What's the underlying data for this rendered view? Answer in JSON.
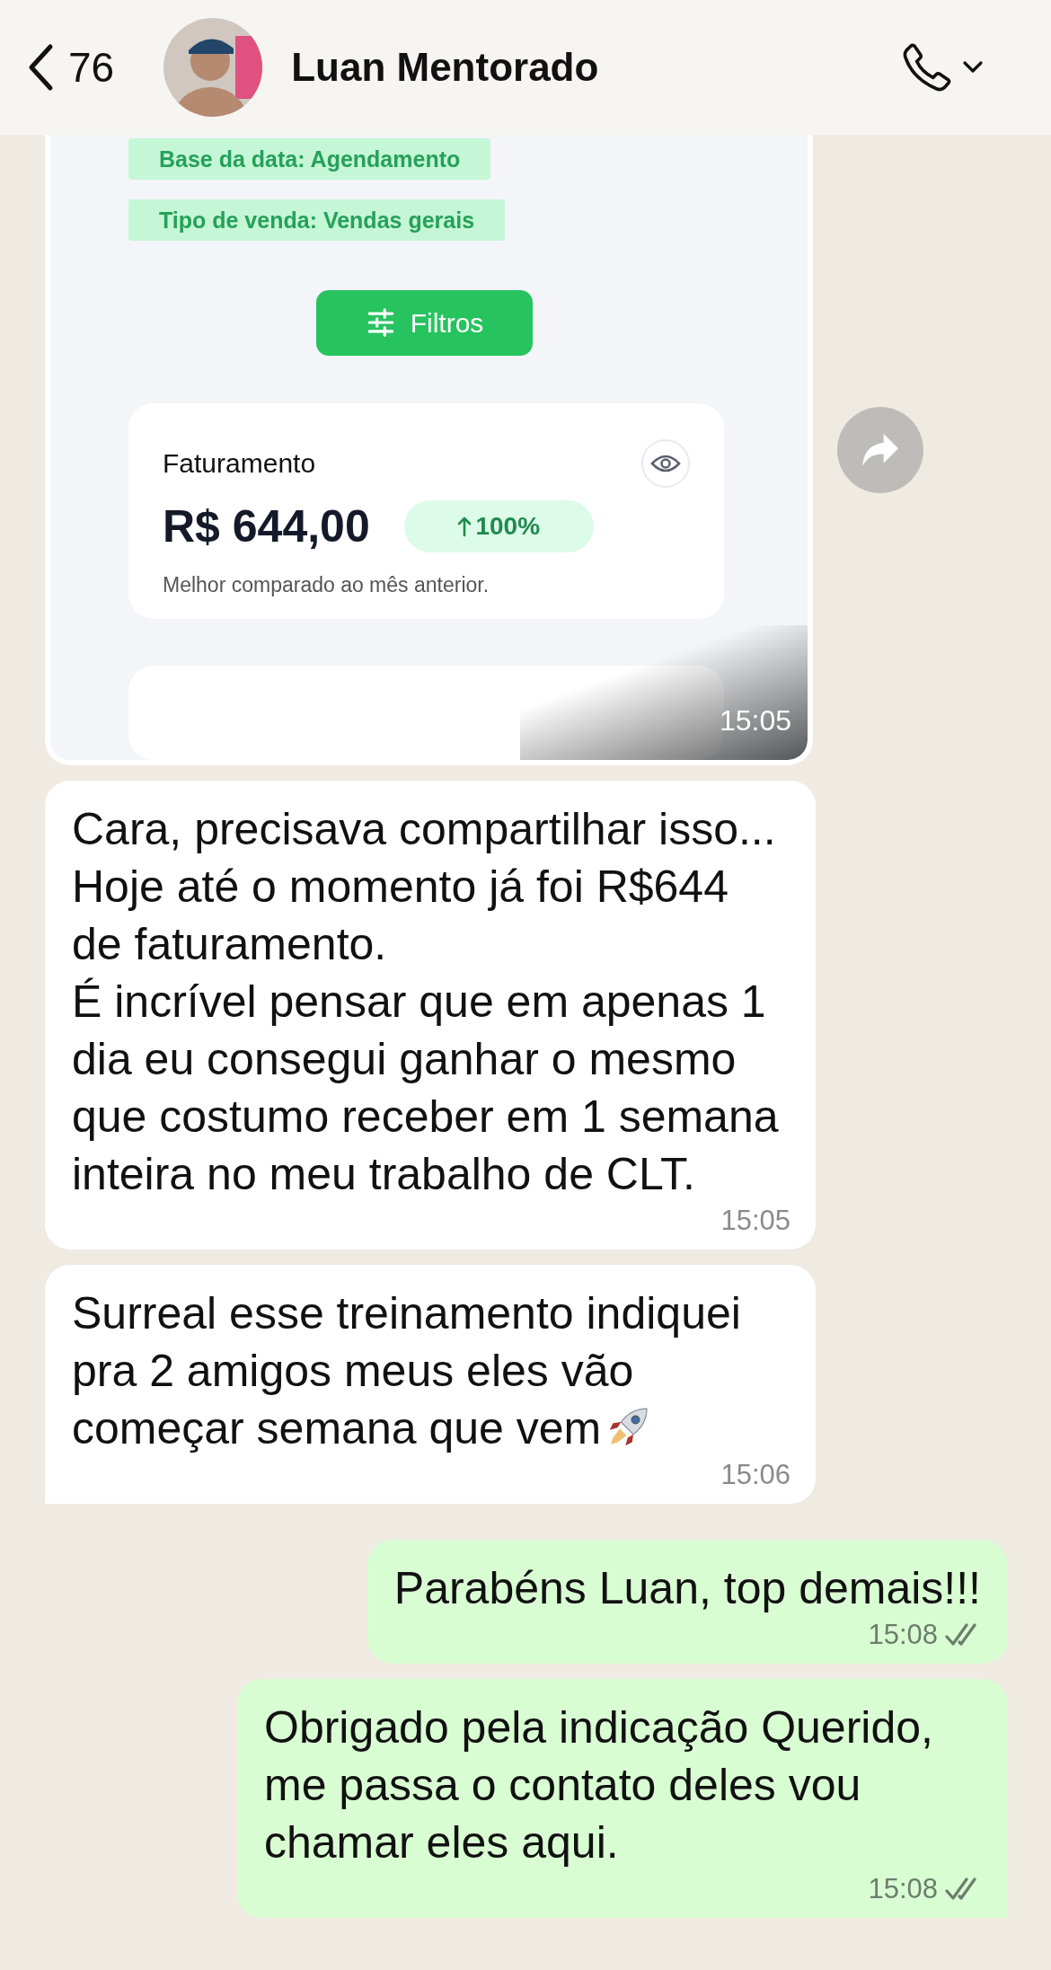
{
  "header": {
    "back_count": "76",
    "contact_name": "Luan Mentorado"
  },
  "messages": [
    {
      "kind": "image",
      "outgoing": false,
      "time": "15:05",
      "forward": true,
      "screenshot": {
        "filter_chips": [
          "Base da data: Agendamento",
          "Tipo de venda: Vendas gerais"
        ],
        "filter_button": "Filtros",
        "card": {
          "title": "Faturamento",
          "value": "R$ 644,00",
          "change": "100%",
          "rising": true,
          "note": "Melhor comparado ao mês anterior."
        }
      }
    },
    {
      "kind": "text",
      "outgoing": false,
      "text": "Cara, precisava compartilhar isso...\nHoje até o momento já foi R$644 de faturamento.\nÉ incrível pensar que em apenas 1 dia eu consegui ganhar o mesmo que costumo receber em 1 semana inteira no meu trabalho de CLT.",
      "time": "15:05",
      "tail": false,
      "rocket": false
    },
    {
      "kind": "text",
      "outgoing": false,
      "text": "Surreal esse treinamento indiquei pra 2 amigos meus eles vão começar semana que vem",
      "time": "15:06",
      "tail": true,
      "rocket": true
    },
    {
      "kind": "text",
      "outgoing": true,
      "text": "Parabéns Luan, top demais!!!",
      "time": "15:08",
      "delivered": true,
      "tail": false,
      "rocket": false
    },
    {
      "kind": "text",
      "outgoing": true,
      "text": "Obrigado pela indicação Querido, me passa o contato deles vou chamar eles aqui.",
      "time": "15:08",
      "delivered": true,
      "tail": true,
      "rocket": false
    }
  ]
}
